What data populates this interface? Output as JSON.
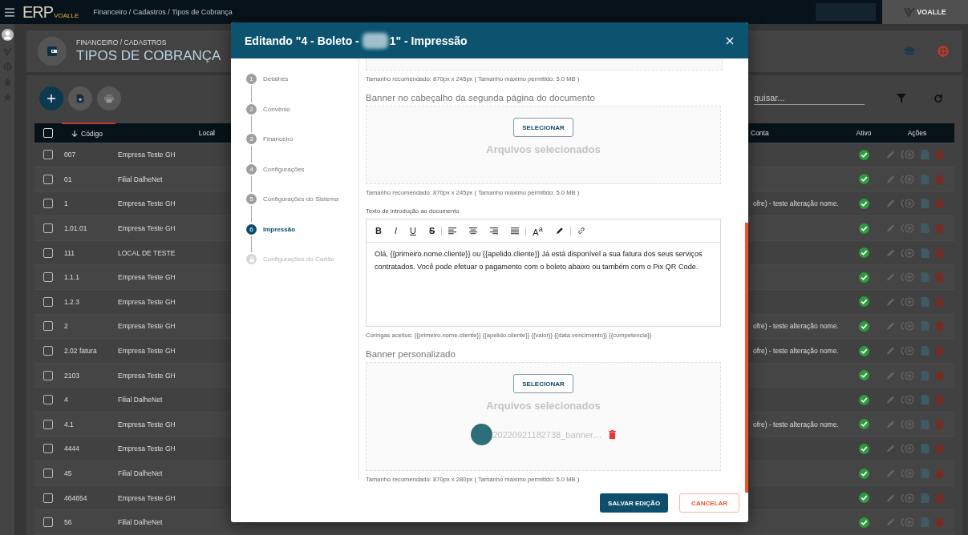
{
  "topbar": {
    "logo": "ERP",
    "logo_sub": "VOALLE",
    "breadcrumb": "Financeiro / Cadastros / Tipos de Cobrança",
    "brand": "VOALLE"
  },
  "page_header": {
    "overline": "FINANCEIRO / CADASTROS",
    "title": "TIPOS DE COBRANÇA"
  },
  "search": {
    "placeholder": "quisar..."
  },
  "table": {
    "columns": [
      "Código",
      "Local",
      "Conta",
      "Ativo",
      "Ações"
    ],
    "header_checked": false,
    "rows": [
      {
        "code": "007",
        "local": "Empresa Teste GH",
        "checked": false,
        "active": true
      },
      {
        "code": "01",
        "local": "Filial DalheNet",
        "checked": false,
        "active": true
      },
      {
        "code": "1",
        "local": "Empresa Teste GH",
        "account": "ofre) - teste alteração nome.",
        "checked": false,
        "active": true
      },
      {
        "code": "1.01.01",
        "local": "Empresa Teste GH",
        "checked": false,
        "active": true
      },
      {
        "code": "111",
        "local": "LOCAL DE TESTE",
        "checked": false,
        "active": true
      },
      {
        "code": "1.1.1",
        "local": "Empresa Teste GH",
        "checked": false,
        "active": true
      },
      {
        "code": "1.2.3",
        "local": "Empresa Teste GH",
        "checked": false,
        "active": true
      },
      {
        "code": "2",
        "local": "Empresa Teste GH",
        "account": "ofre) - teste alteração nome.",
        "checked": false,
        "active": true
      },
      {
        "code": "2.02 fatura",
        "local": "Empresa Teste GH",
        "account": "ofre) - teste alteração nome.",
        "checked": false,
        "active": true
      },
      {
        "code": "2103",
        "local": "Empresa Teste GH",
        "checked": false,
        "active": true
      },
      {
        "code": "4",
        "local": "Filial DalheNet",
        "checked": false,
        "active": true
      },
      {
        "code": "4.1",
        "local": "Empresa Teste GH",
        "account": "ofre) - teste alteração nome.",
        "checked": false,
        "active": true
      },
      {
        "code": "4444",
        "local": "Empresa Teste GH",
        "checked": false,
        "active": true
      },
      {
        "code": "45",
        "local": "Filial DalheNet",
        "checked": false,
        "active": true
      },
      {
        "code": "464654",
        "local": "Empresa Teste GH",
        "checked": false,
        "active": true
      },
      {
        "code": "56",
        "local": "Filial DalheNet",
        "checked": false,
        "active": true
      }
    ]
  },
  "modal": {
    "title_start": "Editando \"4 - Boleto -",
    "title_end": "1\" - Impressão",
    "steps": [
      {
        "number": "1",
        "label": "Detalhes",
        "selected": false,
        "disabled": false
      },
      {
        "number": "2",
        "label": "Convênio",
        "selected": false,
        "disabled": false
      },
      {
        "number": "3",
        "label": "Financeiro",
        "selected": false,
        "disabled": false
      },
      {
        "number": "4",
        "label": "Configurações",
        "selected": false,
        "disabled": false
      },
      {
        "number": "5",
        "label": "Configurações do Sistema",
        "selected": false,
        "disabled": false
      },
      {
        "number": "6",
        "label": "Impressão",
        "selected": true,
        "disabled": false
      },
      {
        "label": "Configurações do Cartão",
        "selected": false,
        "disabled": true
      }
    ],
    "sections": [
      {
        "kind": "upload-tail",
        "hint": "Tamanho recomendado: 870px x 245px ( Tamanho máximo permitido: 5.0 MB )"
      },
      {
        "kind": "upload",
        "title": "Banner no cabeçalho da segunda página do documento",
        "button": "SELECIONAR",
        "files_label": "Arquivos selecionados",
        "hint": "Tamanho recomendado: 870px x 245px ( Tamanho máximo permitido: 5.0 MB )"
      },
      {
        "kind": "editor",
        "label": "Texto de introdução ao documento",
        "toolbar": [
          {
            "kind": "bold",
            "label": "B"
          },
          {
            "kind": "italic",
            "label": "I"
          },
          {
            "kind": "underline",
            "label": "U"
          },
          {
            "kind": "strike",
            "label": "S"
          },
          {
            "kind": "separator"
          },
          {
            "kind": "align-left"
          },
          {
            "kind": "align-center"
          },
          {
            "kind": "align-right"
          },
          {
            "kind": "justify"
          },
          {
            "kind": "separator"
          },
          {
            "kind": "font-size",
            "label": "A$^{a}$"
          },
          {
            "kind": "highlight"
          },
          {
            "kind": "separator"
          },
          {
            "kind": "link"
          }
        ],
        "text": "Olá, {{primeiro.nome.cliente}} ou {{apelido.cliente}} Já está disponível a sua fatura dos seus serviços contratados. Você pode efetuar o pagamento com o boleto abaixo ou também com o Pix QR Code.",
        "hint": "Coringas aceitos: {{primeiro.nome.cliente}} {{apelido.cliente}} {{valor}} {{data.vencimento}} {{competencia}}"
      },
      {
        "kind": "upload",
        "title": "Banner personalizado",
        "button": "SELECIONAR",
        "files_label": "Arquivos selecionados",
        "files": [
          {
            "name": "20220921182738_banner…"
          }
        ],
        "hint": "Tamanho recomendado: 870px x 280px ( Tamanho máximo permitido: 5.0 MB )"
      }
    ],
    "buttons": [
      {
        "kind": "primary",
        "label": "SALVAR EDIÇÃO"
      },
      {
        "kind": "secondary",
        "label": "CANCELAR"
      }
    ]
  }
}
